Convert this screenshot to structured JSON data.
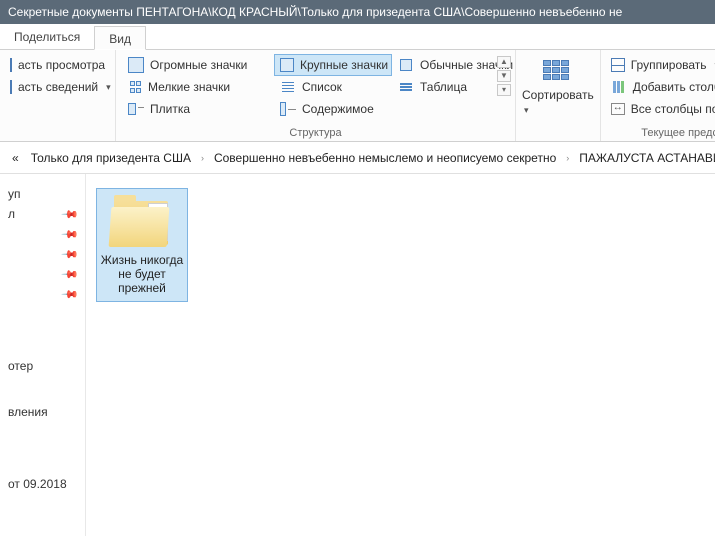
{
  "titlebar": "Секретные документы ПЕНТАГОНА\\КОД КРАСНЫЙ\\Только для призедента США\\Совершенно невъебенно не",
  "tabs": {
    "share": "Поделиться",
    "view": "Вид"
  },
  "ribbon": {
    "panes": {
      "preview": "асть просмотра",
      "details": "асть сведений"
    },
    "layout": {
      "huge": "Огромные значки",
      "large": "Крупные значки",
      "medium": "Обычные значки",
      "small": "Мелкие значки",
      "list": "Список",
      "details": "Таблица",
      "tiles": "Плитка",
      "content": "Содержимое",
      "label": "Структура"
    },
    "sort": {
      "label": "Сортировать"
    },
    "current": {
      "group": "Группировать",
      "addcols": "Добавить столбцы",
      "fitcols": "Все столбцы по разме",
      "label": "Текущее представлени"
    }
  },
  "breadcrumbs": {
    "prefix": "«",
    "c1": "Только для призедента США",
    "c2": "Совершенно невъебенно немыслемо и неописуемо секретно",
    "c3": "ПАЖАЛУСТА АСТАНАВИТ"
  },
  "nav": {
    "i0": "уп",
    "i1": "л",
    "i4": "отер",
    "i5": "вления",
    "i6": "от 09.2018"
  },
  "content": {
    "folder1": "Жизнь никогда не будет прежней"
  }
}
